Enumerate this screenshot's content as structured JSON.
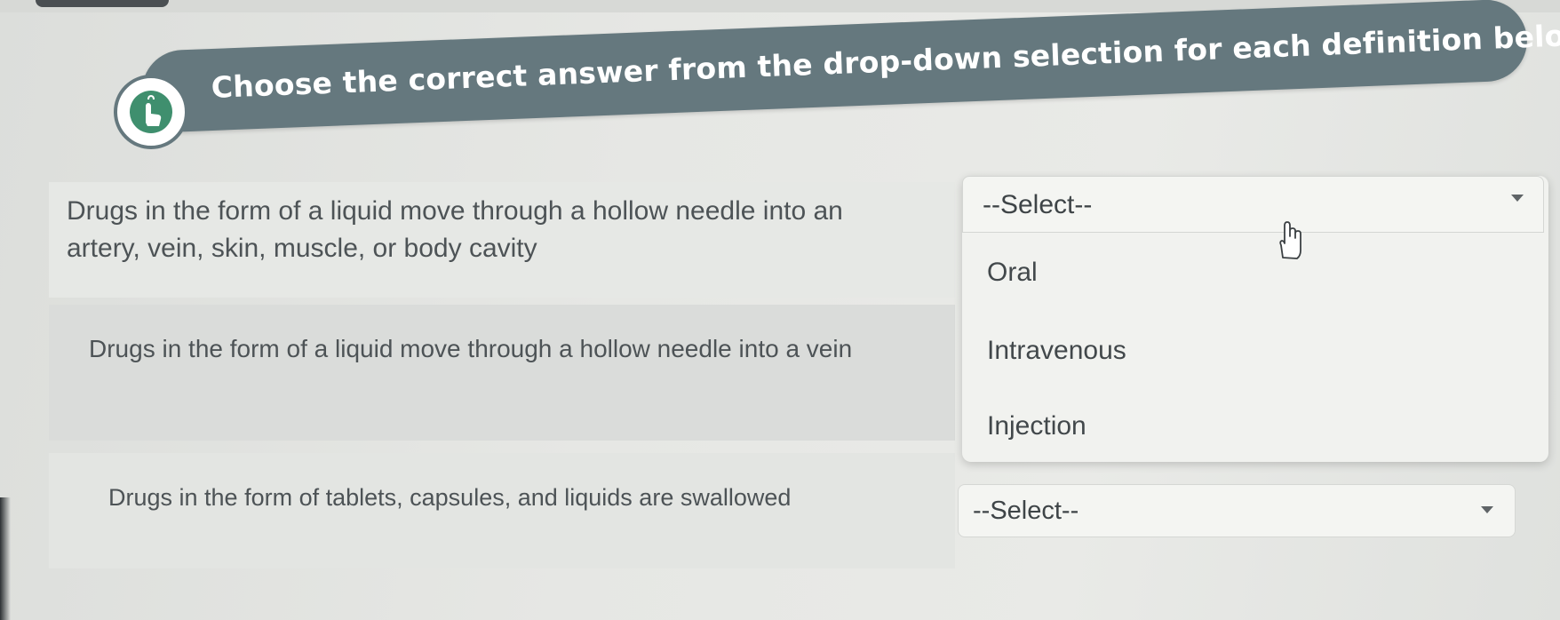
{
  "instruction": {
    "text": "Choose the correct answer from the drop-down selection for each definition below",
    "icon": "hand-pointer-icon"
  },
  "questions": [
    {
      "definition": "Drugs in the form of a liquid move through a hollow needle into an artery, vein, skin, muscle, or body cavity",
      "select_value": "--Select--",
      "expanded": true,
      "options": [
        "Oral",
        "Intravenous",
        "Injection"
      ]
    },
    {
      "definition": "Drugs in the form of a liquid move through a hollow needle into a vein"
    },
    {
      "definition": "Drugs in the form of tablets, capsules, and liquids are swallowed",
      "select_value": "--Select--",
      "expanded": false
    }
  ],
  "cursor": "hand-cursor-icon",
  "colors": {
    "instruction_bar": "#65787e",
    "icon_green": "#3f8f6e",
    "text": "#4d5356"
  }
}
